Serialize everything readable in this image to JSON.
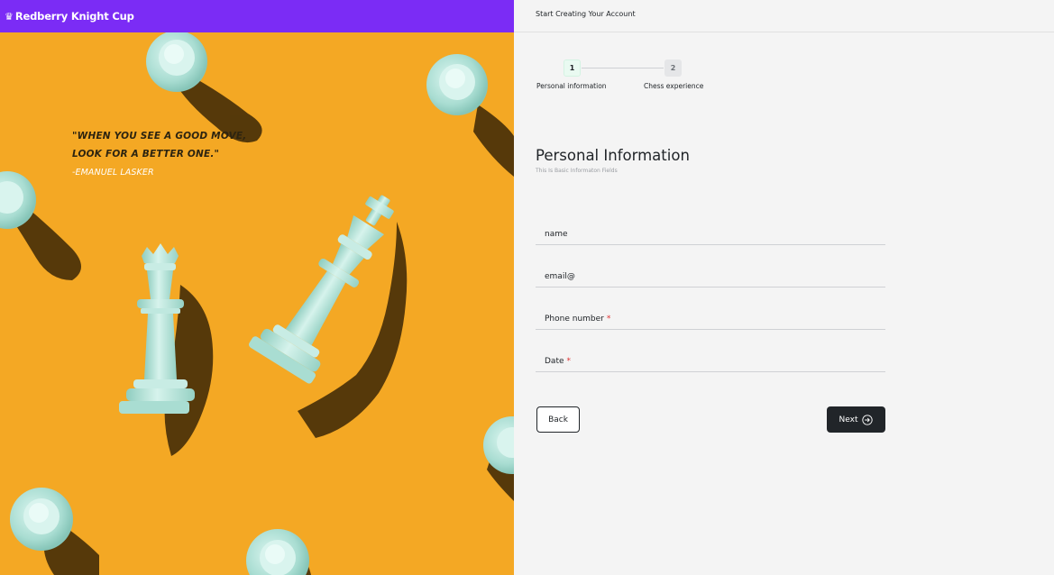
{
  "brand": {
    "icon": "chess-queen-icon",
    "name": "Redberry Knight Cup"
  },
  "hero": {
    "quote_line1": "\"WHEN YOU SEE A GOOD MOVE,",
    "quote_line2": "LOOK FOR A BETTER ONE.\"",
    "author": "-EMANUEL LASKER"
  },
  "header": {
    "title": "Start Creating Your Account"
  },
  "stepper": {
    "steps": [
      {
        "number": "1",
        "label": "Personal information",
        "active": true
      },
      {
        "number": "2",
        "label": "Chess experience",
        "active": false
      }
    ]
  },
  "section": {
    "title": "Personal Information",
    "subtitle": "This Is Basic Informaton Fields"
  },
  "form": {
    "fields": [
      {
        "placeholder": "name",
        "required": false
      },
      {
        "placeholder": "email@",
        "required": false
      },
      {
        "placeholder": "Phone number",
        "required": true
      },
      {
        "placeholder": "Date",
        "required": true
      }
    ],
    "required_mark": "*"
  },
  "actions": {
    "back_label": "Back",
    "next_label": "Next",
    "next_icon": "arrow-right-circle-icon"
  },
  "colors": {
    "brand": "#7b2cf5",
    "hero_bg": "#f4a824",
    "piece": "#b6e4db",
    "button_dark": "#212529",
    "required": "#e03131"
  }
}
